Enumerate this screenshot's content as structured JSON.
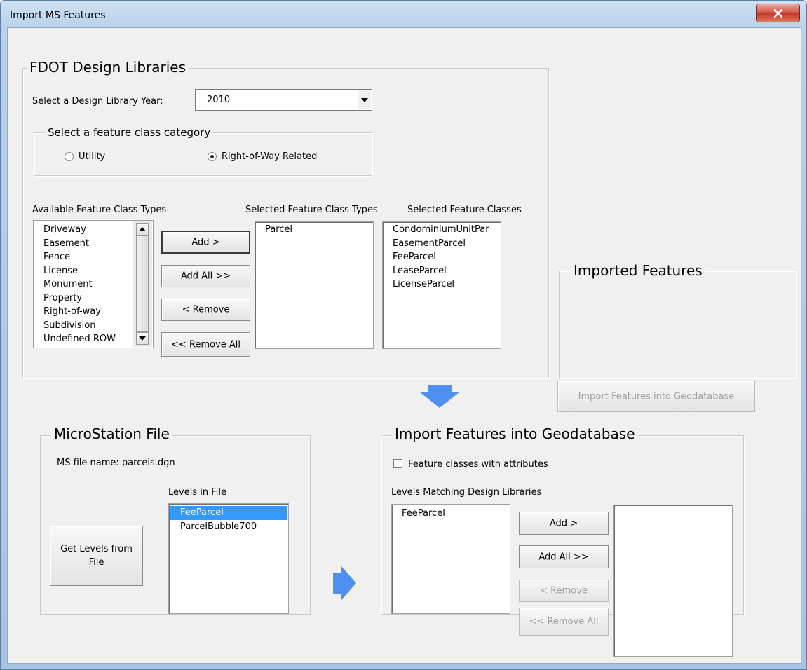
{
  "window": {
    "title": "Import MS Features"
  },
  "design_libraries": {
    "legend": "FDOT Design Libraries",
    "year_label": "Select a Design Library Year:",
    "year_value": "2010",
    "category": {
      "legend": "Select a feature class category",
      "options": [
        {
          "label": "Utility",
          "selected": false
        },
        {
          "label": "Right-of-Way Related",
          "selected": true
        }
      ]
    },
    "available_types_label": "Available Feature Class Types",
    "available_types": [
      "Driveway",
      "Easement",
      "Fence",
      "License",
      "Monument",
      "Property",
      "Right-of-way",
      "Subdivision",
      "Undefined ROW"
    ],
    "selected_types_label": "Selected Feature Class Types",
    "selected_types": [
      "Parcel"
    ],
    "selected_classes_label": "Selected Feature Classes",
    "selected_classes": [
      "CondominiumUnitPar",
      "EasementParcel",
      "FeeParcel",
      "LeaseParcel",
      "LicenseParcel"
    ],
    "buttons": {
      "add": "Add >",
      "add_all": "Add All >>",
      "remove": "< Remove",
      "remove_all": "<< Remove All"
    }
  },
  "imported_features": {
    "legend": "Imported Features",
    "import_button": "Import Features into Geodatabase"
  },
  "microstation": {
    "legend": "MicroStation File",
    "file_name_text": "MS file name: parcels.dgn",
    "levels_label": "Levels in File",
    "levels": [
      "FeeParcel",
      "ParcelBubble700"
    ],
    "selected_level": "FeeParcel",
    "get_levels_button": "Get Levels from File"
  },
  "import_geodatabase": {
    "legend": "Import Features into Geodatabase",
    "attributes_checkbox_label": "Feature classes with attributes",
    "attributes_checked": false,
    "matching_label": "Levels Matching Design Libraries",
    "matching_levels": [
      "FeeParcel"
    ],
    "buttons": {
      "add": "Add >",
      "add_all": "Add All >>",
      "remove": "< Remove",
      "remove_all": "<< Remove All"
    }
  },
  "colors": {
    "arrow": "#4f8ff0",
    "selection": "#3399ff",
    "close_button": "#c8412f"
  }
}
